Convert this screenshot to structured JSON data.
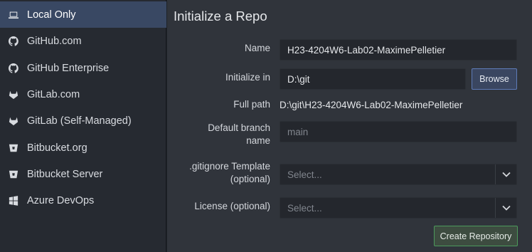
{
  "sidebar": {
    "items": [
      {
        "label": "Local Only",
        "icon": "laptop-icon",
        "active": true
      },
      {
        "label": "GitHub.com",
        "icon": "github-icon"
      },
      {
        "label": "GitHub Enterprise",
        "icon": "github-icon"
      },
      {
        "label": "GitLab.com",
        "icon": "gitlab-icon"
      },
      {
        "label": "GitLab (Self-Managed)",
        "icon": "gitlab-icon"
      },
      {
        "label": "Bitbucket.org",
        "icon": "bitbucket-icon"
      },
      {
        "label": "Bitbucket Server",
        "icon": "bitbucket-icon"
      },
      {
        "label": "Azure DevOps",
        "icon": "windows-icon"
      }
    ]
  },
  "main": {
    "title": "Initialize a Repo",
    "name_label": "Name",
    "name_value": "H23-4204W6-Lab02-MaximePelletier",
    "init_label": "Initialize in",
    "init_value": "D:\\git",
    "browse_label": "Browse",
    "fullpath_label": "Full path",
    "fullpath_value": "D:\\git\\H23-4204W6-Lab02-MaximePelletier",
    "branch_label_1": "Default branch",
    "branch_label_2": "name",
    "branch_placeholder": "main",
    "gitignore_label_1": ".gitignore Template",
    "gitignore_label_2": "(optional)",
    "gitignore_value": "Select...",
    "license_label": "License (optional)",
    "license_value": "Select...",
    "create_label": "Create Repository"
  },
  "colors": {
    "sidebar_active": "#394863",
    "browse_border": "#5e7bb8",
    "create_border": "#4c9a5c"
  }
}
